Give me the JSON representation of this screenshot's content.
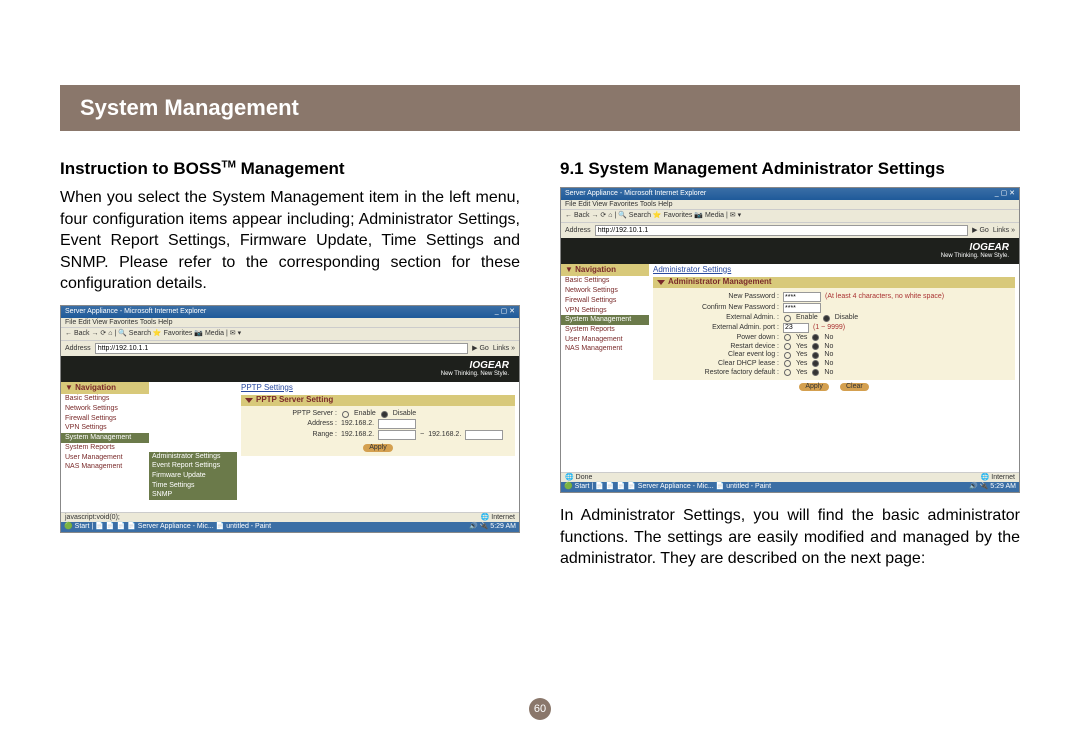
{
  "header": {
    "title": "System Management"
  },
  "left": {
    "title_a": "Instruction to BOSS",
    "title_b": " Management",
    "tm": "TM",
    "body": "When you select the System Management item in the left menu, four configuration items appear including; Administrator Settings, Event Report Settings, Firmware Update, Time Settings and SNMP. Please refer to the corresponding section for these configuration details.",
    "shot": {
      "window_title": "Server Appliance - Microsoft Internet Explorer",
      "menu": "File  Edit  View  Favorites  Tools  Help",
      "toolbar": "← Back  →  ⟳  ⌂  | 🔍 Search  ⭐ Favorites  📷 Media  | ✉ ▾",
      "address_label": "Address",
      "address_value": "http://192.10.1.1",
      "brand": "IOGEAR",
      "brand_sub": "New Thinking. New Style.",
      "nav_header": "▼ Navigation",
      "nav_items": [
        "Basic Settings",
        "Network Settings",
        "Firewall Settings",
        "VPN Settings",
        "System Management",
        "System Reports",
        "User Management",
        "NAS Management"
      ],
      "submenu_items": [
        "Administrator Settings",
        "Event Report Settings",
        "Firmware Update",
        "Time Settings",
        "SNMP"
      ],
      "breadcrumb": "PPTP Settings",
      "panel_title": "PPTP Server Setting",
      "row_server_label": "PPTP Server :",
      "opt_enable": "Enable",
      "opt_disable": "Disable",
      "row_addr_label": "Address :",
      "row_addr_val": "192.168.2.",
      "row_range_label": "Range :",
      "row_range_a": "192.168.2.",
      "row_range_b": "192.168.2.",
      "apply": "Apply",
      "status_left": "javascript:void(0);",
      "status_right": "🌐 Internet",
      "task_left": "🟢 Start | 📄 📄 📄  📄 Server Appliance - Mic...  📄 untitled - Paint",
      "task_right": "🔊 🔌 5:29 AM"
    }
  },
  "right": {
    "title": "9.1 System Management Administrator Settings",
    "body": "In Administrator Settings, you will find the basic administrator functions. The settings are easily modified and managed by the administrator. They are described on the next page:",
    "shot": {
      "window_title": "Server Appliance - Microsoft Internet Explorer",
      "menu": "File  Edit  View  Favorites  Tools  Help",
      "toolbar": "← Back  →  ⟳  ⌂  | 🔍 Search  ⭐ Favorites  📷 Media  | ✉ ▾",
      "address_label": "Address",
      "address_value": "http://192.10.1.1",
      "brand": "IOGEAR",
      "brand_sub": "New Thinking. New Style.",
      "nav_header": "▼ Navigation",
      "nav_items": [
        "Basic Settings",
        "Network Settings",
        "Firewall Settings",
        "VPN Settings",
        "System Management",
        "System Reports",
        "User Management",
        "NAS Management"
      ],
      "breadcrumb": "Administrator Settings",
      "panel_title": "Administrator Management",
      "rows": [
        {
          "label": "New Password :",
          "control": "pwd",
          "hint": "(At least 4 characters, no white space)"
        },
        {
          "label": "Confirm New Password :",
          "control": "pwd"
        },
        {
          "label": "External Admin. :",
          "control": "radio",
          "a": "Enable",
          "b": "Disable"
        },
        {
          "label": "External Admin. port :",
          "control": "text",
          "val": "23",
          "hint": "(1 ~ 9999)"
        },
        {
          "label": "Power down :",
          "control": "radio",
          "a": "Yes",
          "b": "No"
        },
        {
          "label": "Restart device :",
          "control": "radio",
          "a": "Yes",
          "b": "No"
        },
        {
          "label": "Clear event log :",
          "control": "radio",
          "a": "Yes",
          "b": "No"
        },
        {
          "label": "Clear DHCP lease :",
          "control": "radio",
          "a": "Yes",
          "b": "No"
        },
        {
          "label": "Restore factory default :",
          "control": "radio",
          "a": "Yes",
          "b": "No"
        }
      ],
      "apply": "Apply",
      "clear": "Clear",
      "status_left": "🌐 Done",
      "status_right": "🌐 Internet",
      "task_left": "🟢 Start | 📄 📄 📄  📄 Server Appliance - Mic...  📄 untitled - Paint",
      "task_right": "🔊 🔌 5:29 AM"
    }
  },
  "page_number": "60"
}
